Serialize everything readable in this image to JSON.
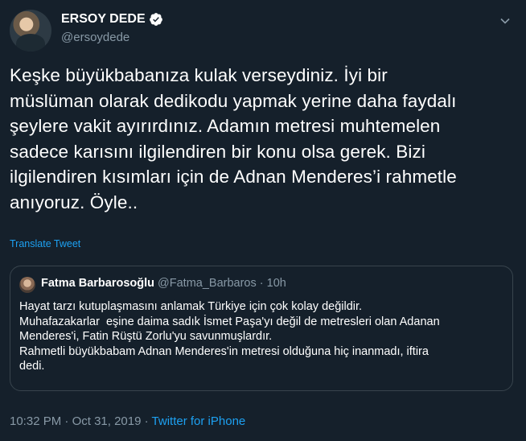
{
  "author": {
    "display_name": "ERSOY DEDE",
    "handle": "@ersoydede",
    "verified_icon": "verified-badge-icon"
  },
  "tweet": {
    "lines": [
      "Keşke büyükbabanıza kulak verseydiniz. İyi bir",
      "müslüman olarak dedikodu yapmak yerine daha faydalı",
      "şeylere vakit ayırırdınız. Adamın metresi muhtemelen",
      "sadece karısını ilgilendiren bir konu olsa gerek. Bizi",
      "ilgilendiren kısımları için de Adnan Menderes’i rahmetle",
      "anıyoruz. Öyle.."
    ],
    "translate_label": "Translate Tweet"
  },
  "quote": {
    "name": "Fatma Barbarosoğlu",
    "handle": "@Fatma_Barbaros",
    "separator": "·",
    "time": "10h",
    "lines": [
      "Hayat tarzı kutuplaşmasını anlamak Türkiye için çok kolay değildir.",
      "Muhafazakarlar  eşine daima sadık İsmet Paşa'yı değil de metresleri olan Adanan",
      "Menderes'i, Fatin Rüştü Zorlu'yu savunmuşlardır.",
      "Rahmetli büyükbabam Adnan Menderes'in metresi olduğuna hiç inanmadı, iftira",
      "dedi."
    ]
  },
  "footer": {
    "time": "10:32 PM",
    "separator1": "·",
    "date": "Oct 31, 2019",
    "separator2": "·",
    "source": "Twitter for iPhone"
  },
  "colors": {
    "background": "#15202b",
    "accent": "#1da1f2",
    "secondary_text": "#8899a6",
    "border": "#38444d"
  }
}
